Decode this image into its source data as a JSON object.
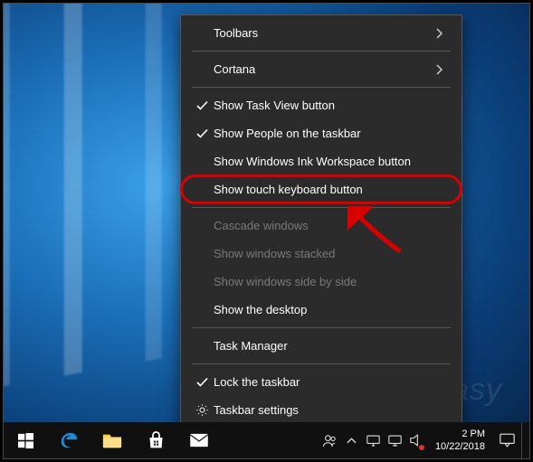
{
  "context_menu": {
    "toolbars": "Toolbars",
    "cortana": "Cortana",
    "show_task_view": "Show Task View button",
    "show_people": "Show People on the taskbar",
    "show_ink": "Show Windows Ink Workspace button",
    "show_touch_kb": "Show touch keyboard button",
    "cascade": "Cascade windows",
    "stacked": "Show windows stacked",
    "side_by_side": "Show windows side by side",
    "show_desktop": "Show the desktop",
    "task_manager": "Task Manager",
    "lock_taskbar": "Lock the taskbar",
    "taskbar_settings": "Taskbar settings"
  },
  "checked": {
    "show_task_view": true,
    "show_people": true,
    "lock_taskbar": true
  },
  "highlighted_item": "show_touch_kb",
  "taskbar": {
    "clock_time": "2 PM",
    "clock_date": "10/22/2018"
  },
  "watermark_text": "driver easy"
}
